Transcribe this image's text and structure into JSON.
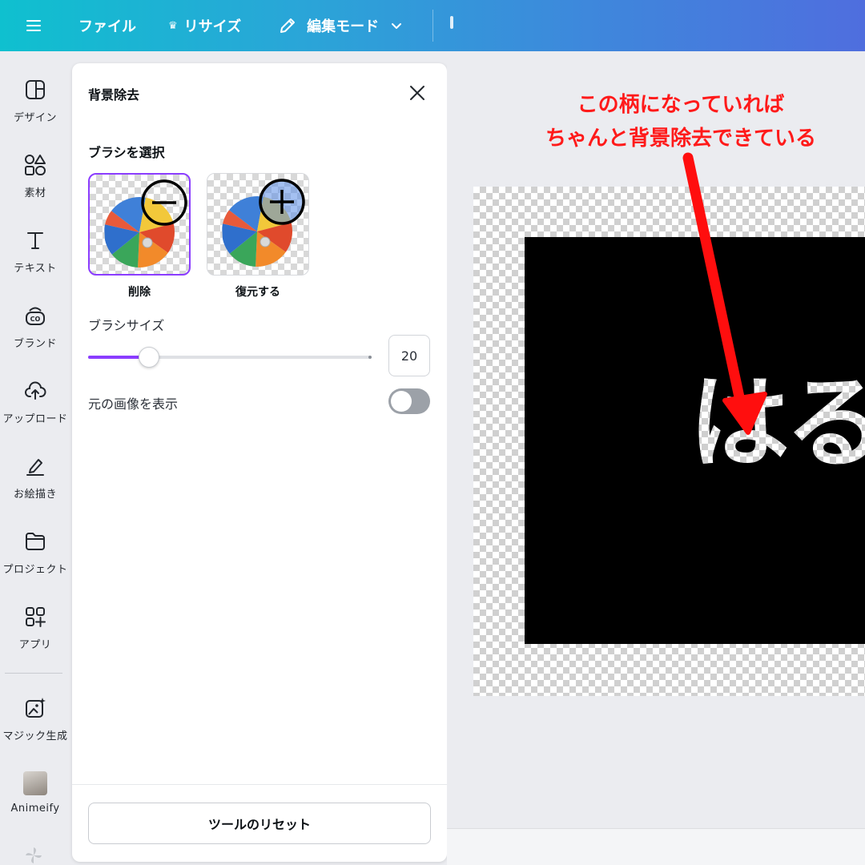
{
  "topbar": {
    "file_label": "ファイル",
    "resize_label": "リサイズ",
    "edit_mode_label": "編集モード"
  },
  "sidebar": {
    "items": [
      {
        "label": "デザイン",
        "icon": "layout-icon"
      },
      {
        "label": "素材",
        "icon": "shapes-icon"
      },
      {
        "label": "テキスト",
        "icon": "text-icon"
      },
      {
        "label": "ブランド",
        "icon": "brand-icon"
      },
      {
        "label": "アップロード",
        "icon": "cloud-upload-icon"
      },
      {
        "label": "お絵描き",
        "icon": "draw-icon"
      },
      {
        "label": "プロジェクト",
        "icon": "folder-icon"
      },
      {
        "label": "アプリ",
        "icon": "apps-icon"
      },
      {
        "label": "マジック生成",
        "icon": "magic-image-icon"
      },
      {
        "label": "Animeify",
        "icon": "animeify-avatar"
      }
    ]
  },
  "panel": {
    "title": "背景除去",
    "brush_heading": "ブラシを選択",
    "brushes": [
      {
        "label": "削除",
        "icon": "minus-circle-icon",
        "selected": true
      },
      {
        "label": "復元する",
        "icon": "plus-circle-icon",
        "selected": false
      }
    ],
    "brush_size_label": "ブラシサイズ",
    "brush_size_value": "20",
    "brush_size_fraction": 0.21,
    "show_original_label": "元の画像を表示",
    "show_original_on": false,
    "reset_label": "ツールのリセット"
  },
  "canvas": {
    "text": "はるラ",
    "annotation_line1": "この柄になっていれば",
    "annotation_line2": "ちゃんと背景除去できている"
  },
  "colors": {
    "accent": "#8b3dff",
    "annotation": "#ff1a1a",
    "topbar_start": "#0fc0cf",
    "topbar_end": "#4f6ede"
  }
}
